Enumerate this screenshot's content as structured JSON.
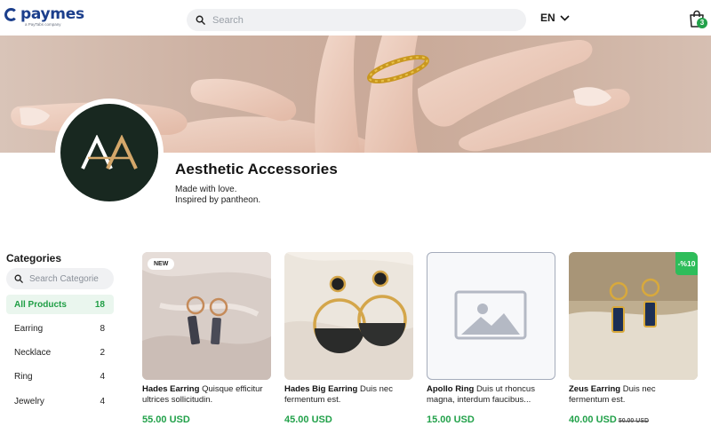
{
  "header": {
    "brand": "paymes",
    "brand_sub": "a PayTabs company",
    "search_placeholder": "Search",
    "language": "EN",
    "cart_count": "3"
  },
  "store": {
    "name": "Aesthetic Accessories",
    "description_line1": "Made with love.",
    "description_line2": "Inspired by pantheon.",
    "logo_letters": "AA"
  },
  "sidebar": {
    "title": "Categories",
    "search_placeholder": "Search Categorie",
    "items": [
      {
        "label": "All Products",
        "count": "18",
        "active": true
      },
      {
        "label": "Earring",
        "count": "8"
      },
      {
        "label": "Necklace",
        "count": "2"
      },
      {
        "label": "Ring",
        "count": "4"
      },
      {
        "label": "Jewelry",
        "count": "4"
      }
    ]
  },
  "products": [
    {
      "name": "Hades Earring",
      "desc": "Quisque efficitur ultrices sollicitudin.",
      "price": "55.00 USD",
      "badge": "NEW"
    },
    {
      "name": "Hades Big Earring",
      "desc": "Duis nec fermentum est.",
      "price": "45.00 USD"
    },
    {
      "name": "Apollo Ring",
      "desc": "Duis ut rhoncus magna, interdum faucibus...",
      "price": "15.00 USD"
    },
    {
      "name": "Zeus Earring",
      "desc": "Duis nec fermentum est.",
      "price": "40.00 USD",
      "old_price": "50.00 USD",
      "badge": "-%10"
    }
  ],
  "colors": {
    "accent_green": "#22a14a",
    "brand_blue": "#1c3f8c",
    "logo_gold": "#d4a76a"
  }
}
